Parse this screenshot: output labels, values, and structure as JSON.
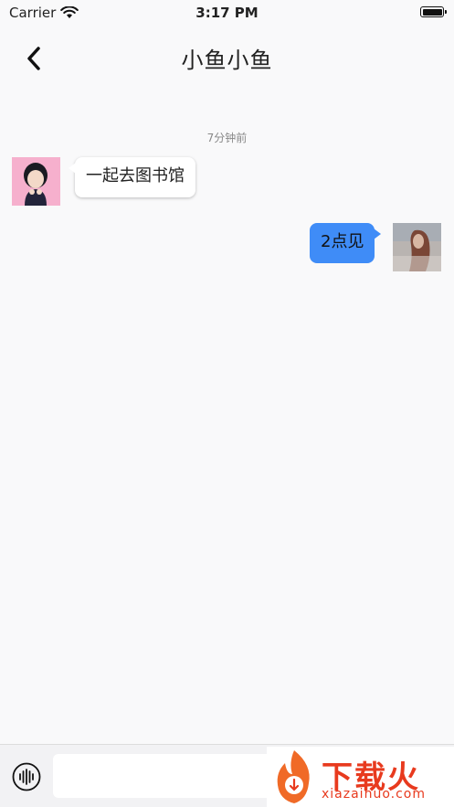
{
  "status_bar": {
    "carrier": "Carrier",
    "time": "3:17 PM"
  },
  "nav": {
    "title": "小鱼小鱼",
    "back_icon": "chevron-left-icon"
  },
  "chat": {
    "timestamp": "7分钟前",
    "messages": [
      {
        "side": "left",
        "text": "一起去图书馆"
      },
      {
        "side": "right",
        "text": "2点见"
      }
    ]
  },
  "input_bar": {
    "voice_icon": "voice-waveform-icon",
    "value": "",
    "placeholder": ""
  },
  "watermark": {
    "brand": "下载火",
    "url": "xiazaihuo.com"
  },
  "colors": {
    "accent": "#3f8cf7",
    "watermark": "#e83a1e"
  }
}
